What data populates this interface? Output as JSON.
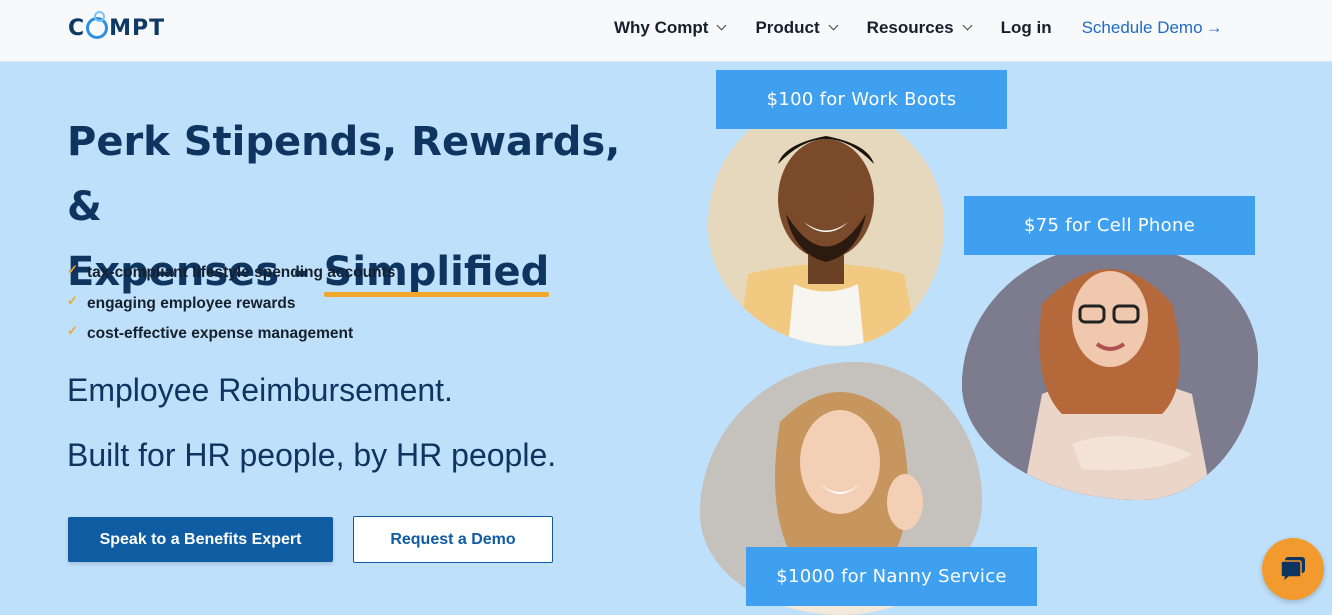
{
  "header": {
    "logo": {
      "pre": "C",
      "post": "MPT"
    },
    "nav": [
      {
        "label": "Why Compt"
      },
      {
        "label": "Product"
      },
      {
        "label": "Resources"
      }
    ],
    "login_label": "Log in",
    "demo_label": "Schedule Demo",
    "demo_arrow": "→"
  },
  "hero": {
    "title_line1": "Perk Stipends, Rewards, &",
    "title_line2_pre": "Expenses - ",
    "title_line2_highlight": "Simplified",
    "bullets": [
      "tax-compliant lifestyle spending accounts",
      "engaging employee rewards",
      "cost-effective expense management"
    ],
    "bullet_icon": "✓",
    "subheading1": "Employee Reimbursement.",
    "subheading2": "Built for HR people, by HR people.",
    "primary_button": "Speak to a Benefits Expert",
    "secondary_button": "Request a Demo"
  },
  "tags": {
    "work_boots": "$100 for Work Boots",
    "cell_phone": "$75 for Cell Phone",
    "nanny": "$1000 for Nanny Service"
  },
  "colors": {
    "background": "#bfe0fb",
    "brand_dark": "#0d3560",
    "primary_button": "#0f5ca3",
    "tag_blue": "#3fa0ef",
    "accent_orange": "#f2a62a",
    "link_blue": "#1f6bc4"
  },
  "icons": {
    "chat": "chat-bubble-icon",
    "nav_chevron": "chevron-down-icon",
    "bullet": "check-icon"
  }
}
